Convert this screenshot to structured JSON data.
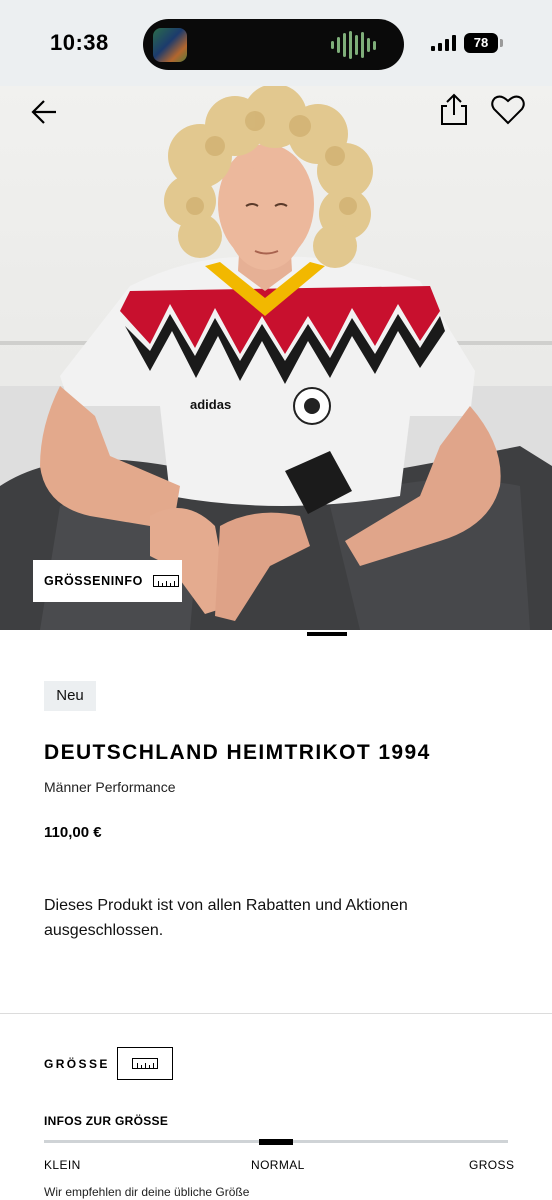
{
  "status_bar": {
    "time": "10:38",
    "battery_level": "78",
    "signal_icon": "cellular-signal-icon"
  },
  "header": {
    "back_icon": "arrow-left-icon",
    "share_icon": "share-icon",
    "wishlist_icon": "heart-icon"
  },
  "hero": {
    "size_info_label": "GRÖSSENINFO",
    "size_info_icon": "ruler-icon",
    "image_description_icon": "product-photo"
  },
  "product": {
    "badge": "Neu",
    "title": "DEUTSCHLAND HEIMTRIKOT 1994",
    "subtitle": "Männer Performance",
    "price": "110,00 €",
    "notice": "Dieses Produkt ist von allen Rabatten und Aktionen ausgeschlossen."
  },
  "size_section": {
    "label": "GRÖSSE",
    "guide_icon": "ruler-icon"
  },
  "fit": {
    "heading": "INFOS ZUR GRÖSSE",
    "small": "KLEIN",
    "normal": "NORMAL",
    "large": "GROSS",
    "note": "Wir empfehlen dir deine übliche Größe",
    "position_fraction": 0.5
  },
  "colors": {
    "status_bar_bg": "#eceff1",
    "badge_bg": "#eceff1",
    "accent": "#000000"
  }
}
